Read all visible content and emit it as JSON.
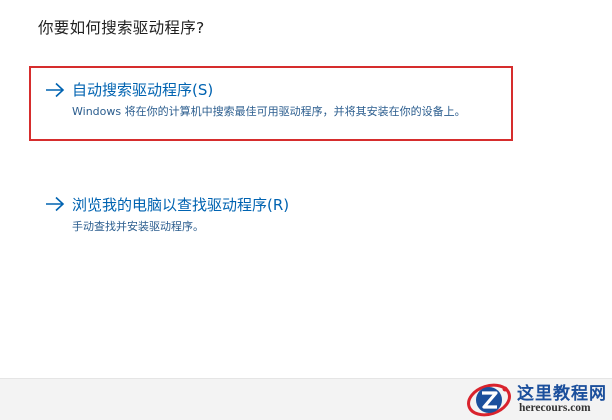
{
  "heading": "你要如何搜索驱动程序?",
  "options": [
    {
      "title": "自动搜索驱动程序(S)",
      "description": "Windows 将在你的计算机中搜索最佳可用驱动程序，并将其安装在你的设备上。",
      "icon": "arrow-right-icon",
      "highlighted": true
    },
    {
      "title": "浏览我的电脑以查找驱动程序(R)",
      "description": "手动查找并安装驱动程序。",
      "icon": "arrow-right-icon",
      "highlighted": false
    }
  ],
  "watermark": {
    "name": "这里教程网",
    "domain": "herecours.com"
  },
  "colors": {
    "link": "#0063b1",
    "highlight_border": "#d62d2d",
    "footer_bg": "#f3f3f3"
  }
}
